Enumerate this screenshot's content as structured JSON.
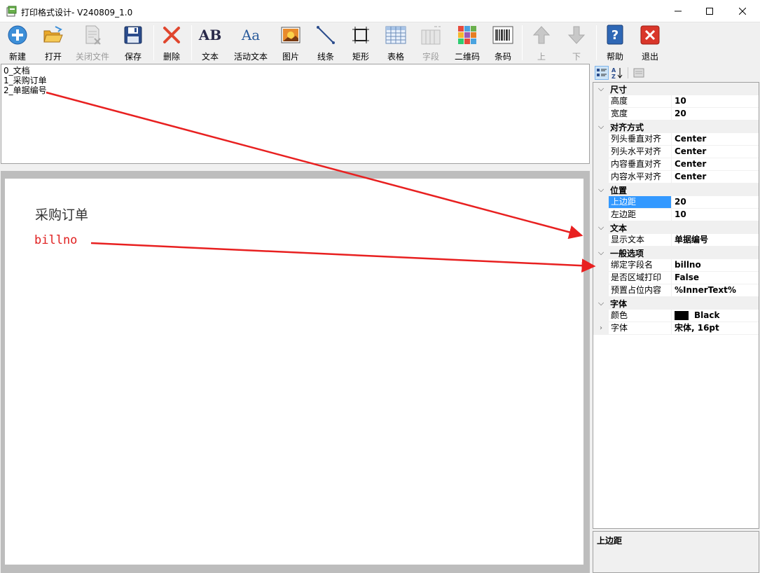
{
  "window": {
    "title": "打印格式设计- V240809_1.0"
  },
  "toolbar": {
    "new": "新建",
    "open": "打开",
    "close_file": "关闭文件",
    "save": "保存",
    "delete": "删除",
    "text": "文本",
    "active_text": "活动文本",
    "image": "图片",
    "line": "线条",
    "rect": "矩形",
    "table": "表格",
    "field": "字段",
    "qrcode": "二维码",
    "barcode": "条码",
    "up": "上",
    "down": "下",
    "help": "帮助",
    "exit": "退出",
    "text_icon_glyph": "AB",
    "active_text_icon_glyph": "Aa"
  },
  "elements": [
    "0_文档",
    "1_采购订单",
    "2_单据编号"
  ],
  "page": {
    "title": "采购订单",
    "field": "billno"
  },
  "properties": {
    "categories": [
      {
        "label": "尺寸",
        "rows": [
          {
            "name": "高度",
            "value": "10"
          },
          {
            "name": "宽度",
            "value": "20"
          }
        ]
      },
      {
        "label": "对齐方式",
        "rows": [
          {
            "name": "列头垂直对齐",
            "value": "Center"
          },
          {
            "name": "列头水平对齐",
            "value": "Center"
          },
          {
            "name": "内容垂直对齐",
            "value": "Center"
          },
          {
            "name": "内容水平对齐",
            "value": "Center"
          }
        ]
      },
      {
        "label": "位置",
        "rows": [
          {
            "name": "上边距",
            "value": "20"
          },
          {
            "name": "左边距",
            "value": "10"
          }
        ]
      },
      {
        "label": "文本",
        "rows": [
          {
            "name": "显示文本",
            "value": "单据编号"
          }
        ]
      },
      {
        "label": "一般选项",
        "rows": [
          {
            "name": "绑定字段名",
            "value": "billno"
          },
          {
            "name": "是否区域打印",
            "value": "False"
          },
          {
            "name": "预置占位内容",
            "value": "%InnerText%"
          }
        ]
      },
      {
        "label": "字体",
        "rows": [
          {
            "name": "颜色",
            "value": "Black"
          },
          {
            "name": "字体",
            "value": "宋体, 16pt"
          }
        ]
      }
    ],
    "description_title": "上边距"
  },
  "colors": {
    "accent_red": "#e82020",
    "selection": "#3399ff"
  }
}
